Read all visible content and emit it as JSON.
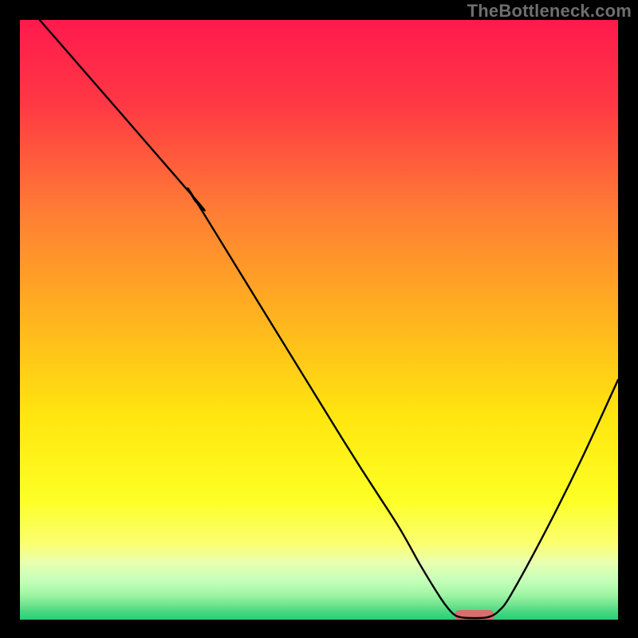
{
  "watermark": "TheBottleneck.com",
  "chart_data": {
    "type": "line",
    "title": "",
    "xlabel": "",
    "ylabel": "",
    "x_range": [
      0,
      100
    ],
    "y_range": [
      0,
      100
    ],
    "grid": false,
    "gradient_stops": [
      {
        "offset": 0.0,
        "color": "#ff1a4d"
      },
      {
        "offset": 0.14,
        "color": "#ff3844"
      },
      {
        "offset": 0.32,
        "color": "#ff7d34"
      },
      {
        "offset": 0.5,
        "color": "#ffb41e"
      },
      {
        "offset": 0.66,
        "color": "#ffe60f"
      },
      {
        "offset": 0.8,
        "color": "#fdff24"
      },
      {
        "offset": 0.873,
        "color": "#fbff70"
      },
      {
        "offset": 0.905,
        "color": "#e8ffb0"
      },
      {
        "offset": 0.935,
        "color": "#c4ffba"
      },
      {
        "offset": 0.957,
        "color": "#a2f6a5"
      },
      {
        "offset": 0.975,
        "color": "#72e48f"
      },
      {
        "offset": 0.985,
        "color": "#4dd982"
      },
      {
        "offset": 1.0,
        "color": "#26cf76"
      }
    ],
    "curve_points": [
      {
        "x": 3.3,
        "y": 100
      },
      {
        "x": 29.0,
        "y": 70.5
      },
      {
        "x": 29.3,
        "y": 69.8
      },
      {
        "x": 30.0,
        "y": 68.9
      },
      {
        "x": 54.0,
        "y": 30.0
      },
      {
        "x": 63.0,
        "y": 16.0
      },
      {
        "x": 67.0,
        "y": 9.0
      },
      {
        "x": 70.4,
        "y": 3.5
      },
      {
        "x": 72.0,
        "y": 1.4
      },
      {
        "x": 73.0,
        "y": 0.6
      },
      {
        "x": 74.5,
        "y": 0.3
      },
      {
        "x": 77.5,
        "y": 0.3
      },
      {
        "x": 78.8,
        "y": 0.6
      },
      {
        "x": 80.0,
        "y": 1.4
      },
      {
        "x": 82.0,
        "y": 4.0
      },
      {
        "x": 88.0,
        "y": 15.0
      },
      {
        "x": 94.0,
        "y": 27.0
      },
      {
        "x": 100.0,
        "y": 40.0
      }
    ],
    "marker": {
      "x_center": 76.0,
      "y": 0.7,
      "width": 6.7,
      "height": 1.8,
      "color": "#d76d6d"
    },
    "annotations": []
  }
}
